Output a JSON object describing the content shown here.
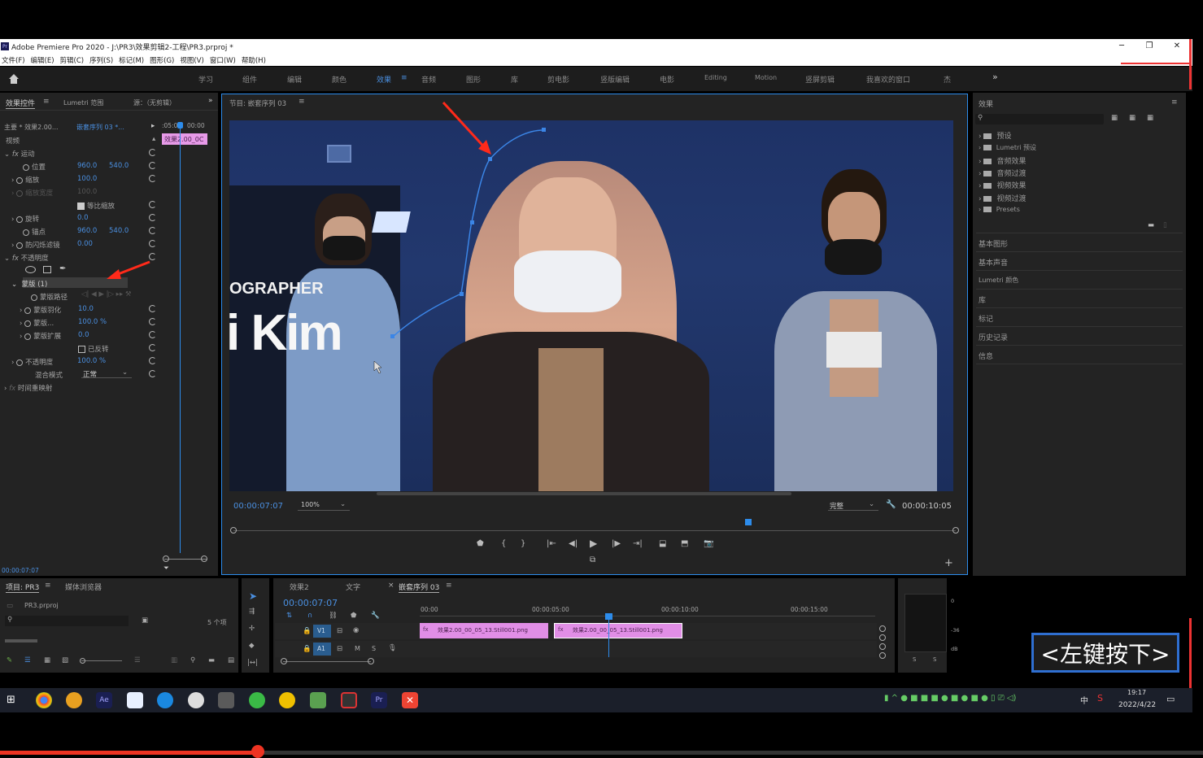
{
  "title_bar": {
    "app_badge": "Pr",
    "text": "Adobe Premiere Pro 2020 - J:\\PR3\\效果剪辑2-工程\\PR3.prproj *"
  },
  "menu": [
    "文件(F)",
    "编辑(E)",
    "剪辑(C)",
    "序列(S)",
    "标记(M)",
    "图形(G)",
    "视图(V)",
    "窗口(W)",
    "帮助(H)"
  ],
  "workspaces": [
    "学习",
    "组件",
    "编辑",
    "颜色",
    "效果",
    "音频",
    "图形",
    "库",
    "剪电影",
    "竖版编辑",
    "电影",
    "Editing",
    "Motion",
    "竖屏剪辑",
    "我喜欢的窗口",
    "杰"
  ],
  "active_workspace": "效果",
  "effect_controls": {
    "tabs": [
      "效果控件",
      "Lumetri 范围",
      "源：（无剪辑）"
    ],
    "source_label": "主要 * 效果2.00...",
    "sequence_label": "嵌套序列 03 *...",
    "time_labels": [
      ":05:00",
      "00:00"
    ],
    "clip_label": "效果2.00_0C",
    "section_video": "视频",
    "motion": "运动",
    "position": {
      "label": "位置",
      "x": "960.0",
      "y": "540.0"
    },
    "scale": {
      "label": "缩放",
      "value": "100.0"
    },
    "scale_width": {
      "label": "缩放宽度",
      "value": "100.0"
    },
    "uniform_scale": "等比缩放",
    "rotation": {
      "label": "旋转",
      "value": "0.0"
    },
    "anchor": {
      "label": "锚点",
      "x": "960.0",
      "y": "540.0"
    },
    "antiflicker": {
      "label": "防闪烁滤镜",
      "value": "0.00"
    },
    "opacity_section": "不透明度",
    "mask": "蒙版 (1)",
    "mask_path": "蒙版路径",
    "mask_feather": {
      "label": "蒙版羽化",
      "value": "10.0"
    },
    "mask_opacity": {
      "label": "蒙版...",
      "value": "100.0 %"
    },
    "mask_expand": {
      "label": "蒙版扩展",
      "value": "0.0"
    },
    "inverted": "已反转",
    "opacity": {
      "label": "不透明度",
      "value": "100.0 %"
    },
    "blend_mode": {
      "label": "混合模式",
      "value": "正常"
    },
    "time_remap": "时间重映射",
    "timecode": "00:00:07:07"
  },
  "program_monitor": {
    "title": "节目: 嵌套序列 03",
    "overlay_text_1": "OGRAPHER",
    "overlay_text_2": "i Kim",
    "timecode": "00:00:07:07",
    "zoom": "100%",
    "quality": "完整",
    "duration": "00:00:10:05"
  },
  "effects_panel": {
    "title": "效果",
    "items": [
      "预设",
      "Lumetri 预设",
      "音频效果",
      "音频过渡",
      "视频效果",
      "视频过渡",
      "Presets"
    ],
    "sections": [
      "基本图形",
      "基本声音",
      "Lumetri 颜色",
      "库",
      "标记",
      "历史记录",
      "信息"
    ]
  },
  "project_panel": {
    "tabs": [
      "项目: PR3",
      "媒体浏览器"
    ],
    "file": "PR3.prproj",
    "count": "5 个项"
  },
  "timeline": {
    "tabs": [
      "效果2",
      "文字",
      "嵌套序列 03"
    ],
    "timecode": "00:00:07:07",
    "ruler": [
      "00:00",
      "00:00:05:00",
      "00:00:10:00",
      "00:00:15:00"
    ],
    "tracks": [
      "V1",
      "A1"
    ],
    "clips": [
      "效果2.00_00_05_13.Still001.png",
      "效果2.00_00_05_13.Still001.png"
    ]
  },
  "audio_meter": {
    "labels": [
      "0",
      "-36",
      "dB"
    ],
    "channels": [
      "S",
      "S"
    ]
  },
  "overlay_hint": "<左键按下>",
  "taskbar": {
    "time": "19:17",
    "date": "2022/4/22",
    "lang": "中"
  },
  "colors": {
    "accent_blue": "#2d8ceb",
    "clip_pink": "#e18ee6",
    "panel_bg": "#232323",
    "hint_border": "#2f6fd1"
  }
}
